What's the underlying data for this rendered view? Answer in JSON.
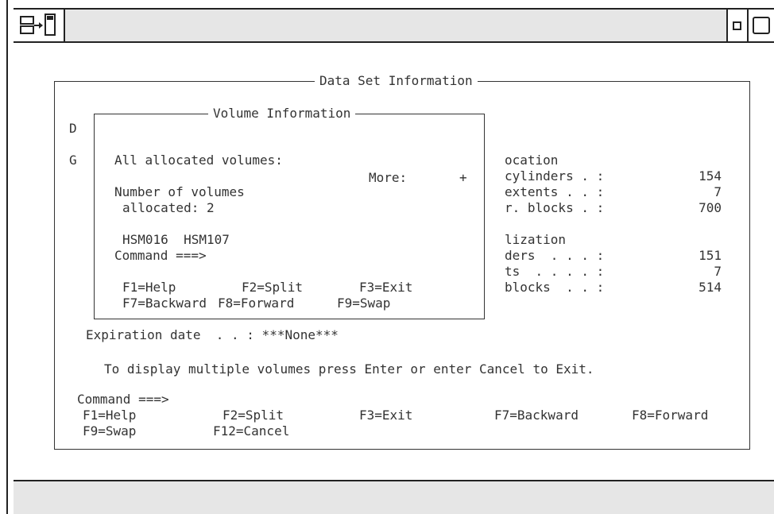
{
  "window": {
    "icons": {
      "left": "split-window-icon",
      "minimize": "minimize-icon",
      "maximize": "maximize-icon"
    }
  },
  "outer_panel": {
    "title": "Data Set Information",
    "left_letters": [
      "D",
      "G"
    ],
    "right_col": {
      "h1": "ocation",
      "rows1": [
        {
          "label": "cylinders . :",
          "value": "154"
        },
        {
          "label": "extents . . :",
          "value": "7"
        },
        {
          "label": "r. blocks . :",
          "value": "700"
        }
      ],
      "h2": "lization",
      "rows2": [
        {
          "label": "ders  . . . :",
          "value": "151"
        },
        {
          "label": "ts  . . . . :",
          "value": "7"
        },
        {
          "label": "blocks  . . :",
          "value": "514"
        }
      ]
    },
    "expiration": "Expiration date  . . : ***None***",
    "instruction": "To display multiple volumes press Enter or enter Cancel to Exit.",
    "command_label": "Command ===>",
    "fkeys": [
      "F1=Help",
      "F2=Split",
      "F3=Exit",
      "F7=Backward",
      "F8=Forward",
      "F9=Swap",
      "F12=Cancel"
    ]
  },
  "inner_panel": {
    "title": "Volume Information",
    "all_allocated": "All allocated volumes:",
    "more": "More:",
    "more_sign": "+",
    "num_volumes": "Number of volumes",
    "allocated": "allocated: 2",
    "volumes": "HSM016  HSM107",
    "command_label": "Command ===>",
    "fkeys": [
      "F1=Help",
      "F2=Split",
      "F3=Exit",
      "F7=Backward",
      "F8=Forward",
      "F9=Swap"
    ]
  }
}
